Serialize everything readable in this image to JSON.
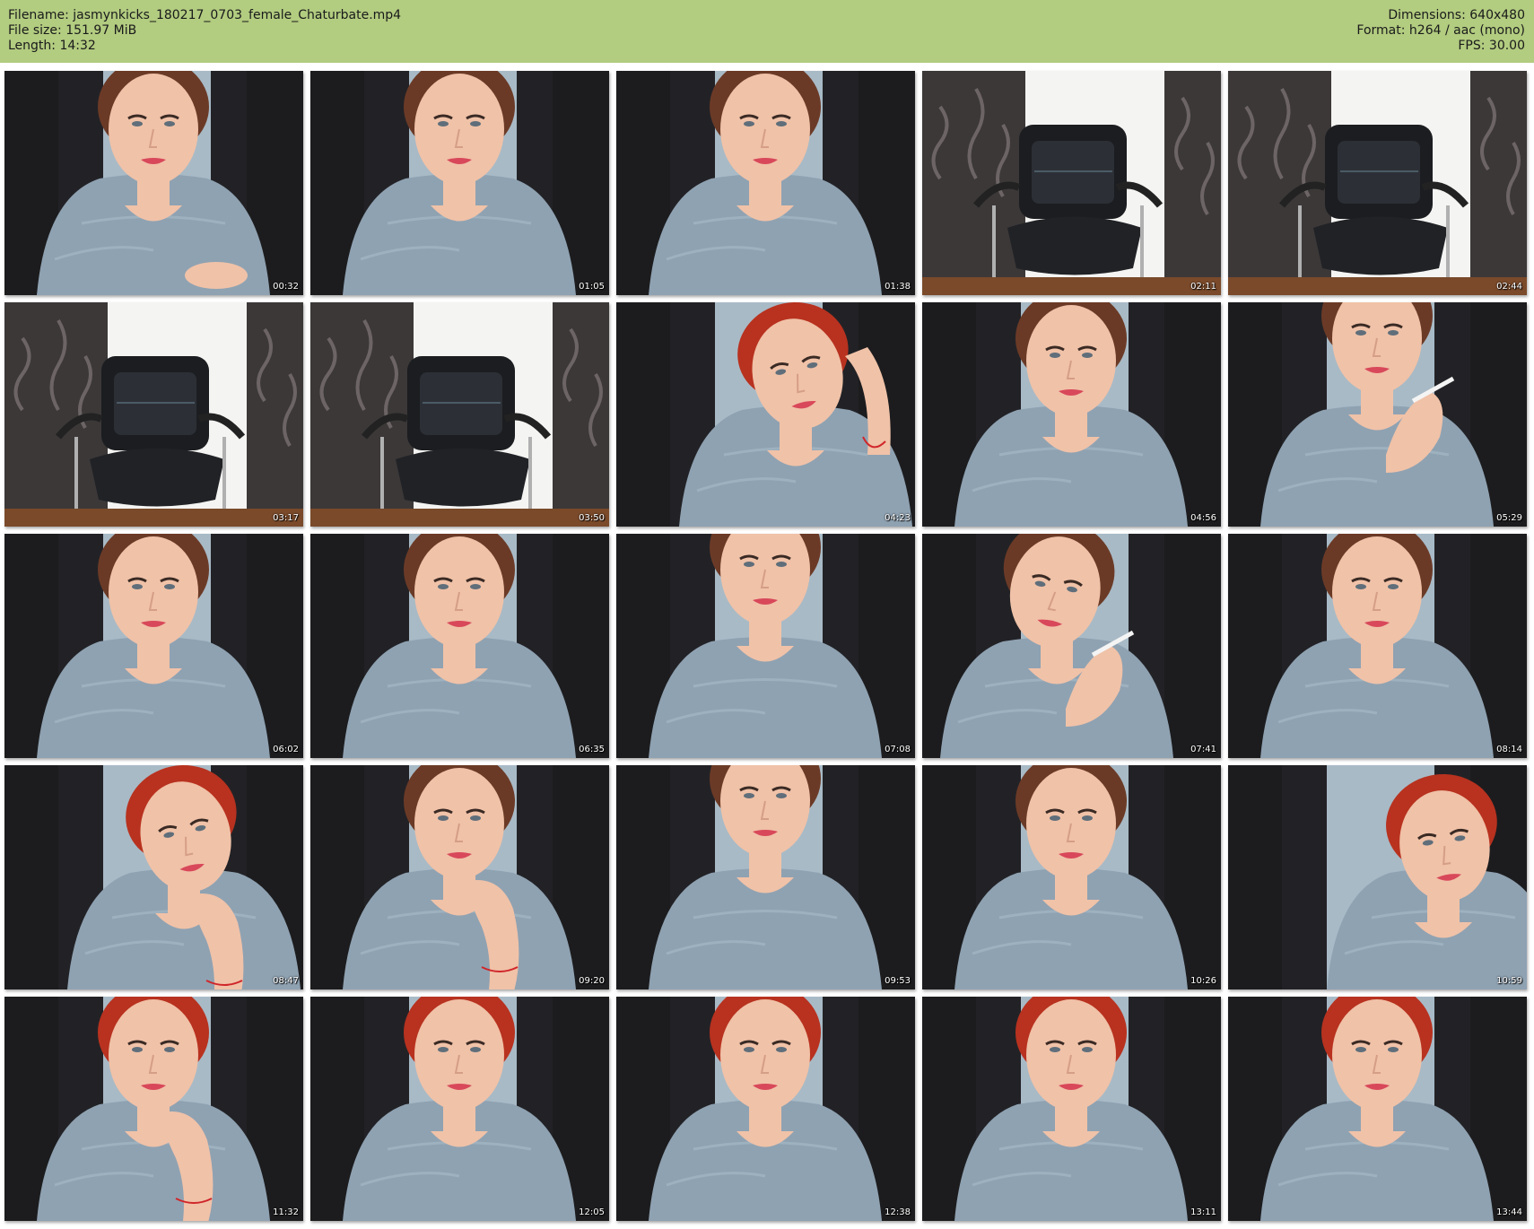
{
  "header": {
    "filename": "Filename: jasmynkicks_180217_0703_female_Chaturbate.mp4",
    "file_size": "File size: 151.97 MiB",
    "length": "Length: 14:32",
    "dimensions": "Dimensions: 640x480",
    "format": "Format: h264 / aac (mono)",
    "fps": "FPS: 30.00"
  },
  "colors": {
    "header_bg": "#b2cc80",
    "sweater": "#8fa2b2",
    "skin": "#f0c2a8",
    "hair_brown": "#6b3a26",
    "hair_red": "#b8321f",
    "curtain": "#1c1c1e",
    "chair": "#1b1d20"
  },
  "thumbnails": [
    {
      "timestamp": "00:32",
      "scene": "person",
      "hair": "brown",
      "pose": "center",
      "hand": "low"
    },
    {
      "timestamp": "01:05",
      "scene": "person",
      "hair": "brown",
      "pose": "center",
      "hand": "none"
    },
    {
      "timestamp": "01:38",
      "scene": "person",
      "hair": "brown",
      "pose": "center",
      "hand": "none"
    },
    {
      "timestamp": "02:11",
      "scene": "chair",
      "hair": "",
      "pose": "",
      "hand": ""
    },
    {
      "timestamp": "02:44",
      "scene": "chair",
      "hair": "",
      "pose": "",
      "hand": ""
    },
    {
      "timestamp": "03:17",
      "scene": "chair",
      "hair": "",
      "pose": "",
      "hand": ""
    },
    {
      "timestamp": "03:50",
      "scene": "chair",
      "hair": "",
      "pose": "",
      "hand": ""
    },
    {
      "timestamp": "04:23",
      "scene": "person",
      "hair": "red",
      "pose": "tilt-right",
      "hand": "head"
    },
    {
      "timestamp": "04:56",
      "scene": "person",
      "hair": "brown",
      "pose": "center",
      "hand": "none"
    },
    {
      "timestamp": "05:29",
      "scene": "person",
      "hair": "brown",
      "pose": "center-high",
      "hand": "cigarette"
    },
    {
      "timestamp": "06:02",
      "scene": "person",
      "hair": "brown",
      "pose": "center",
      "hand": "none"
    },
    {
      "timestamp": "06:35",
      "scene": "person",
      "hair": "brown",
      "pose": "center",
      "hand": "none"
    },
    {
      "timestamp": "07:08",
      "scene": "person",
      "hair": "brown",
      "pose": "center-high",
      "hand": "none"
    },
    {
      "timestamp": "07:41",
      "scene": "person",
      "hair": "brown",
      "pose": "tilt-left",
      "hand": "cigarette"
    },
    {
      "timestamp": "08:14",
      "scene": "person",
      "hair": "brown",
      "pose": "center",
      "hand": "none"
    },
    {
      "timestamp": "08:47",
      "scene": "person",
      "hair": "red",
      "pose": "tilt-right",
      "hand": "chin"
    },
    {
      "timestamp": "09:20",
      "scene": "person",
      "hair": "brown",
      "pose": "center",
      "hand": "chin"
    },
    {
      "timestamp": "09:53",
      "scene": "person",
      "hair": "brown",
      "pose": "center-high",
      "hand": "none"
    },
    {
      "timestamp": "10:26",
      "scene": "person",
      "hair": "brown",
      "pose": "center",
      "hand": "none"
    },
    {
      "timestamp": "10:59",
      "scene": "person",
      "hair": "red",
      "pose": "right",
      "hand": "none"
    },
    {
      "timestamp": "11:32",
      "scene": "person",
      "hair": "red",
      "pose": "center",
      "hand": "chin"
    },
    {
      "timestamp": "12:05",
      "scene": "person",
      "hair": "red",
      "pose": "center",
      "hand": "none"
    },
    {
      "timestamp": "12:38",
      "scene": "person",
      "hair": "red",
      "pose": "center",
      "hand": "none"
    },
    {
      "timestamp": "13:11",
      "scene": "person",
      "hair": "red",
      "pose": "center",
      "hand": "none"
    },
    {
      "timestamp": "13:44",
      "scene": "person",
      "hair": "red",
      "pose": "center",
      "hand": "none"
    }
  ]
}
